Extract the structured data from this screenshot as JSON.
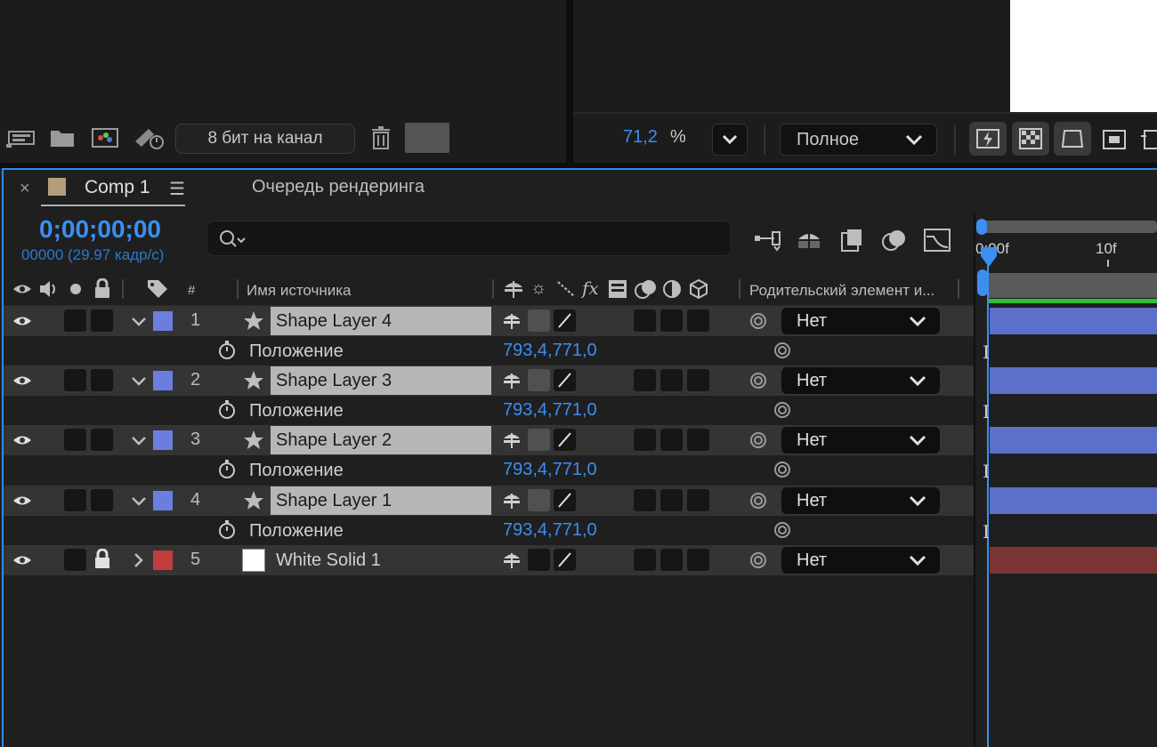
{
  "project_panel": {
    "bit_depth_label": "8 бит на канал",
    "icons": [
      "interpret-footage-icon",
      "folder-icon",
      "new-comp-icon",
      "render-settings-icon",
      "trash-icon"
    ]
  },
  "viewer": {
    "zoom_value": "71,2",
    "zoom_unit": "%",
    "resolution": "Полное"
  },
  "timeline": {
    "tab_name": "Comp 1",
    "render_queue_tab": "Очередь рендеринга",
    "timecode": "0;00;00;00",
    "frame_info": "00000 (29.97 кадр/с)",
    "ruler_labels": [
      "0:00f",
      "10f"
    ],
    "columns": {
      "number": "#",
      "source_name": "Имя источника",
      "parent": "Родительский элемент и..."
    },
    "layers": [
      {
        "index": "1",
        "name": "Shape Layer 4",
        "color": "#6b7ee0",
        "parent": "Нет",
        "property": "Положение",
        "value": "793,4,771,0",
        "bar_color": "#5c6fc9"
      },
      {
        "index": "2",
        "name": "Shape Layer 3",
        "color": "#6b7ee0",
        "parent": "Нет",
        "property": "Положение",
        "value": "793,4,771,0",
        "bar_color": "#5c6fc9"
      },
      {
        "index": "3",
        "name": "Shape Layer 2",
        "color": "#6b7ee0",
        "parent": "Нет",
        "property": "Положение",
        "value": "793,4,771,0",
        "bar_color": "#5c6fc9"
      },
      {
        "index": "4",
        "name": "Shape Layer 1",
        "color": "#6b7ee0",
        "parent": "Нет",
        "property": "Положение",
        "value": "793,4,771,0",
        "bar_color": "#5c6fc9"
      },
      {
        "index": "5",
        "name": "White Solid 1",
        "color": "#c23c3c",
        "parent": "Нет",
        "bar_color": "#7a3434"
      }
    ]
  }
}
